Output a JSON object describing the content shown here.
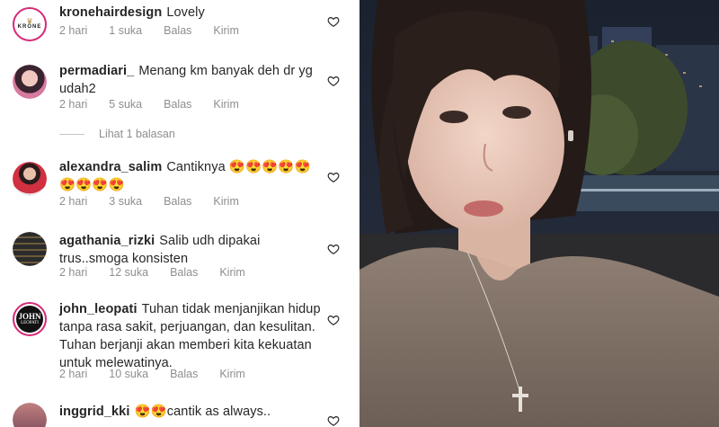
{
  "comments": [
    {
      "username": "kronehairdesign",
      "text": "Lovely",
      "time": "2 hari",
      "likes": "1 suka",
      "reply": "Balas",
      "send": "Kirim",
      "avatar_text": "KRONE"
    },
    {
      "username": "permadiari_",
      "text": "Menang km banyak deh dr yg udah2",
      "time": "2 hari",
      "likes": "5 suka",
      "reply": "Balas",
      "send": "Kirim"
    },
    {
      "username": "alexandra_salim",
      "text": "Cantiknya 😍😍😍😍😍😍😍😍😍",
      "time": "2 hari",
      "likes": "3 suka",
      "reply": "Balas",
      "send": "Kirim"
    },
    {
      "username": "agathania_rizki",
      "text": "Salib udh dipakai trus..smoga konsisten",
      "time": "2 hari",
      "likes": "12 suka",
      "reply": "Balas",
      "send": "Kirim"
    },
    {
      "username": "john_leopati",
      "text": "Tuhan tidak menjanjikan hidup tanpa rasa sakit, perjuangan, dan kesulitan. Tuhan berjanji akan memberi kita kekuatan untuk melewatinya.",
      "time": "2 hari",
      "likes": "10 suka",
      "reply": "Balas",
      "send": "Kirim",
      "avatar_text_1": "JOHN",
      "avatar_text_2": "LEOPATI"
    },
    {
      "username": "inggrid_kki",
      "text": "😍😍cantik as always..",
      "time": "",
      "likes": "",
      "reply": "",
      "send": ""
    }
  ],
  "view_replies": "Lihat 1 balasan",
  "colors": {
    "text": "#262626",
    "meta": "#8e8e8e",
    "ring": "#d62976",
    "heart": "#262626"
  }
}
